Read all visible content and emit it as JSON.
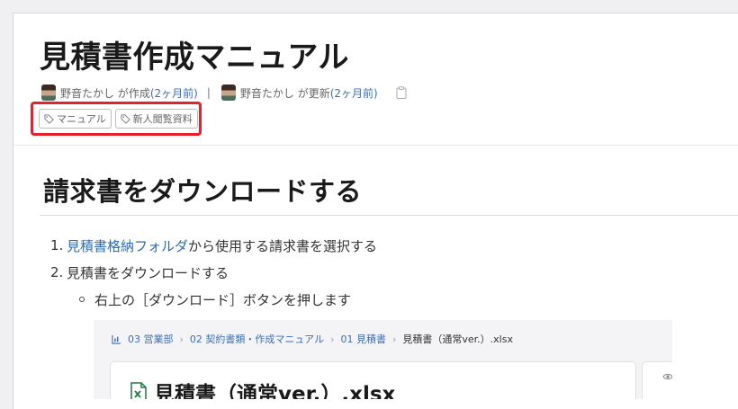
{
  "page": {
    "title": "見積書作成マニュアル",
    "meta": {
      "created_by": "野音たかし が作成",
      "created_time": "(2ヶ月前)",
      "separator": "|",
      "updated_by": "野音たかし が更新",
      "updated_time": "(2ヶ月前)"
    },
    "tags": [
      "マニュアル",
      "新人閲覧資料"
    ],
    "highlight_color": "#e8202e"
  },
  "section": {
    "heading": "請求書をダウンロードする",
    "steps": [
      {
        "num": "1.",
        "link": "見積書格納フォルダ",
        "text": "から使用する請求書を選択する"
      },
      {
        "num": "2.",
        "text": "見積書をダウンロードする"
      }
    ],
    "substep": "右上の［ダウンロード］ボタンを押します"
  },
  "embedded_screenshot": {
    "breadcrumb": [
      "03 営業部",
      "02 契約書類・作成マニュアル",
      "01 見積書",
      "見積書（通常ver.）.xlsx"
    ],
    "file_title": "見積書（通常ver.）.xlsx",
    "file_icon": "excel-icon"
  }
}
